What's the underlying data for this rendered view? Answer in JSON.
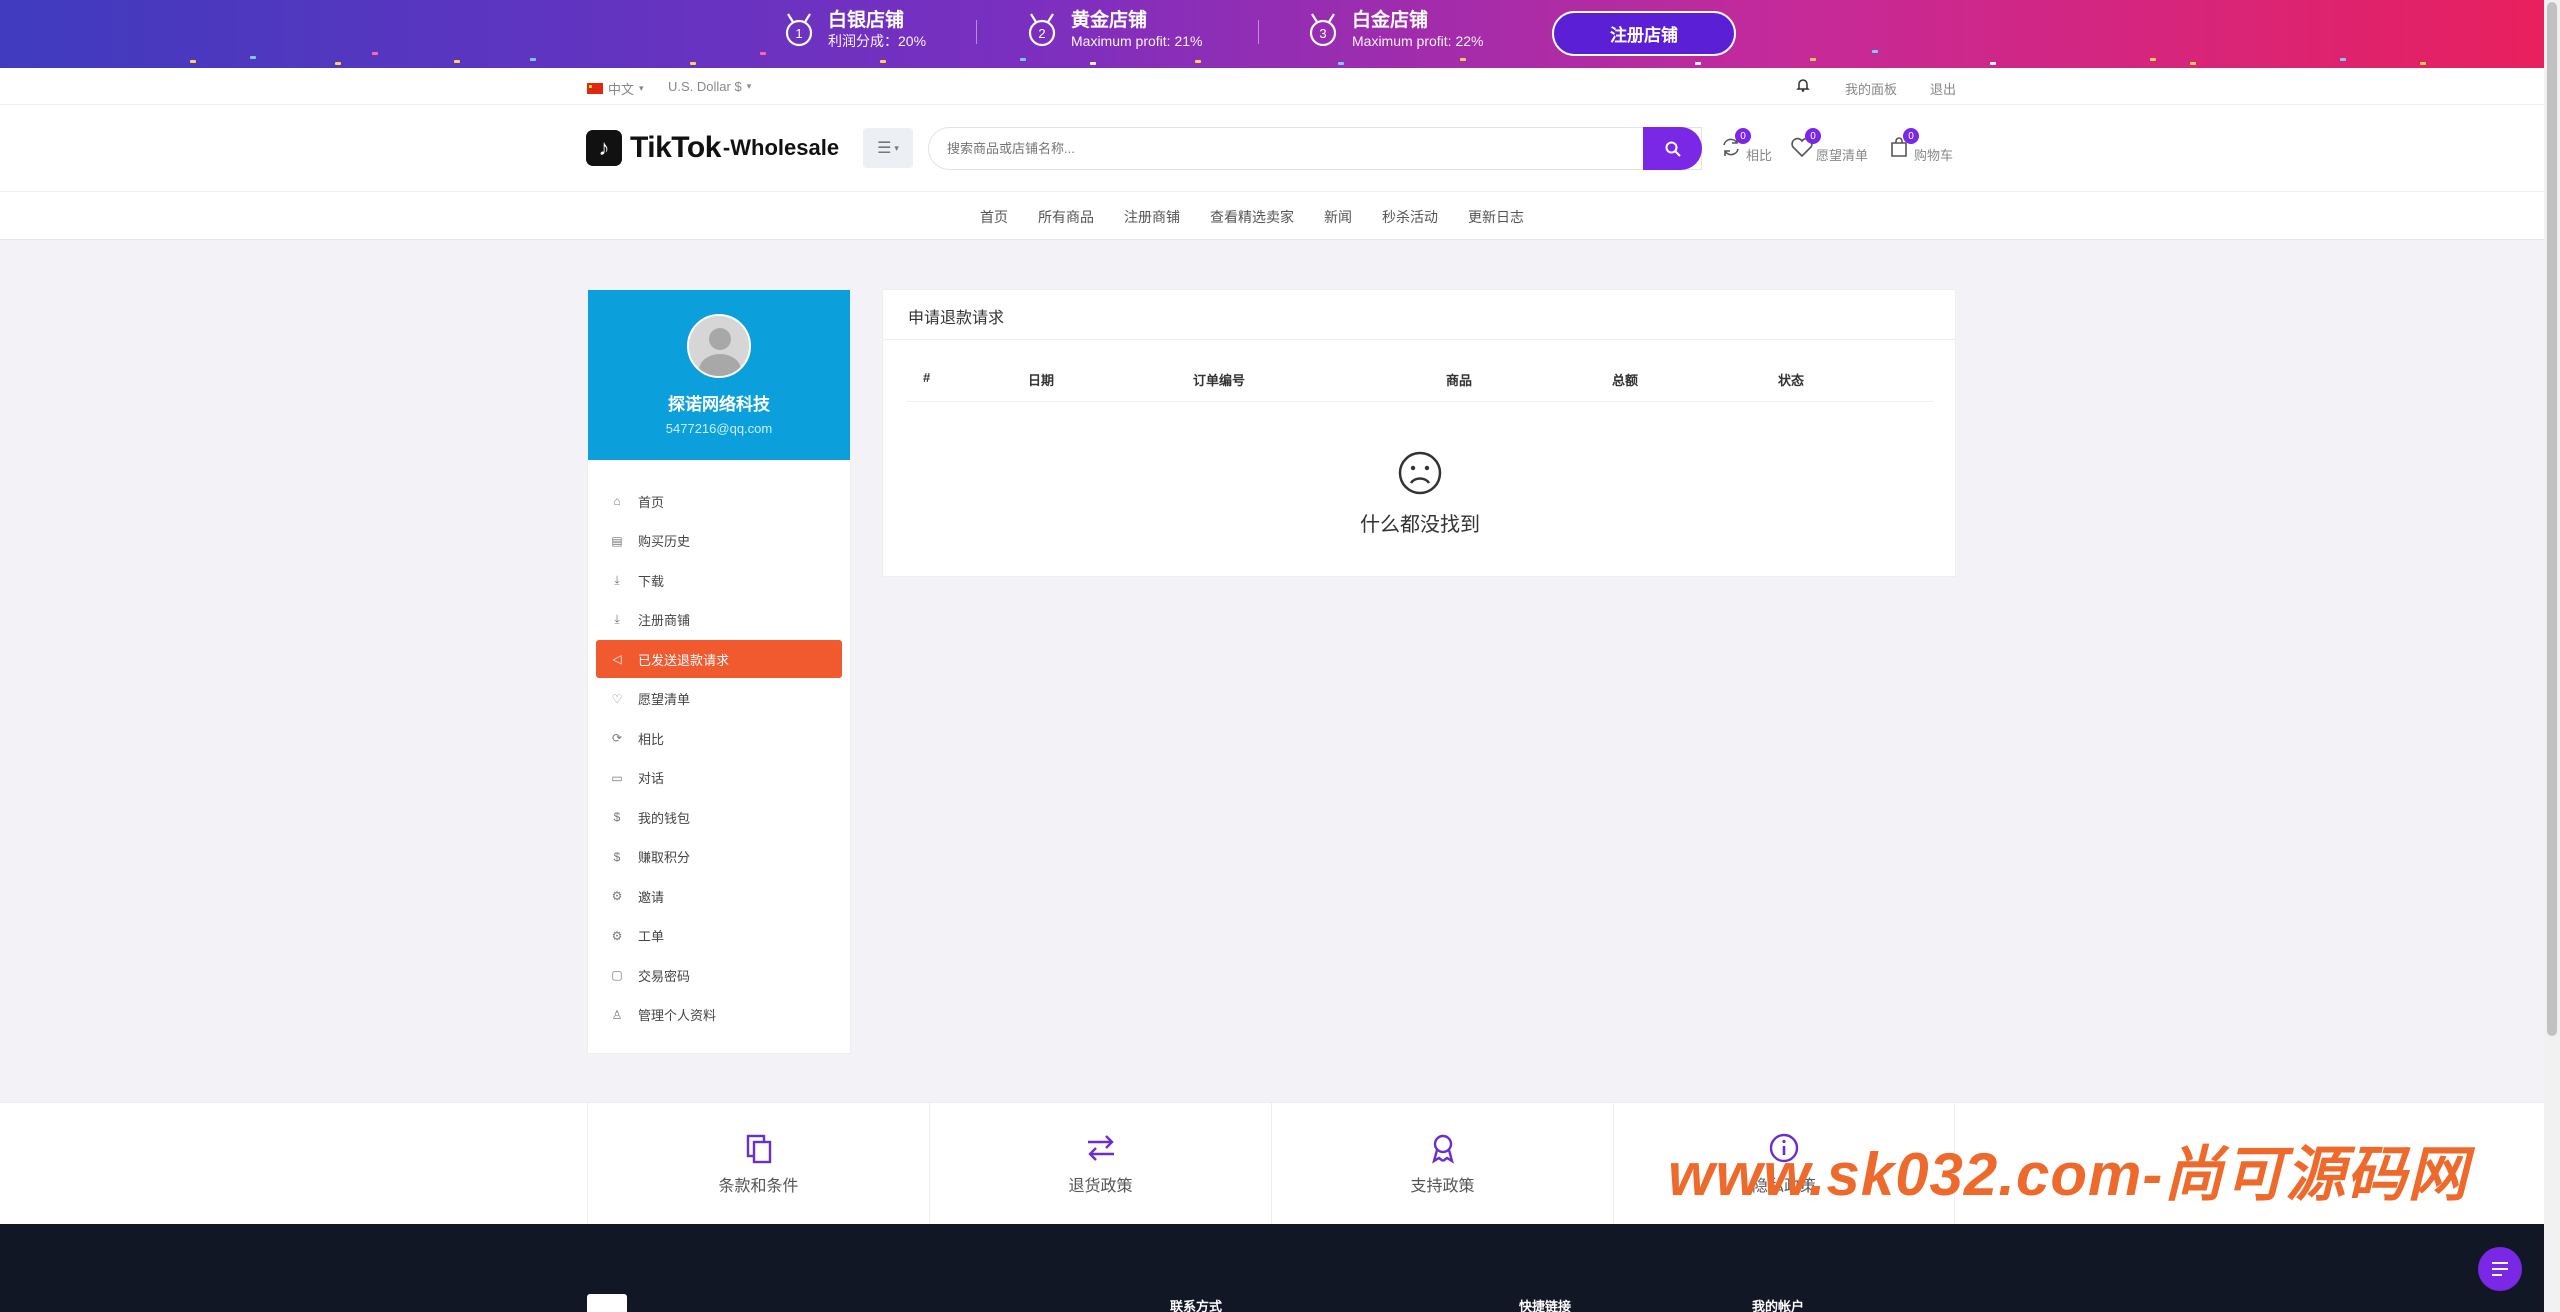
{
  "banner": {
    "tiers": [
      {
        "title": "白银店铺",
        "sub": "利润分成：20%"
      },
      {
        "title": "黄金店铺",
        "sub": "Maximum profit: 21%"
      },
      {
        "title": "白金店铺",
        "sub": "Maximum profit: 22%"
      }
    ],
    "register_label": "注册店铺",
    "colors": {
      "start": "#3f3bbf",
      "end": "#e8205e",
      "button": "#5b1fd6"
    }
  },
  "topbar": {
    "language": "中文",
    "currency": "U.S. Dollar $",
    "dashboard": "我的面板",
    "logout": "退出"
  },
  "header": {
    "brand": "TikTok",
    "brand_sub": "-Wholesale",
    "search_placeholder": "搜索商品或店铺名称...",
    "compare": {
      "label": "相比",
      "count": "0"
    },
    "wishlist": {
      "label": "愿望清单",
      "count": "0"
    },
    "cart": {
      "label": "购物车",
      "count": "0"
    },
    "accent": "#7a28e6"
  },
  "nav": {
    "links": [
      "首页",
      "所有商品",
      "注册商铺",
      "查看精选卖家",
      "新闻",
      "秒杀活动",
      "更新日志"
    ]
  },
  "sidebar": {
    "user_name": "探诺网络科技",
    "user_email": "5477216@qq.com",
    "items": [
      {
        "label": "首页",
        "icon": "home-icon"
      },
      {
        "label": "购买历史",
        "icon": "file-icon"
      },
      {
        "label": "下载",
        "icon": "download-icon"
      },
      {
        "label": "注册商铺",
        "icon": "download-icon"
      },
      {
        "label": "已发送退款请求",
        "icon": "megaphone-icon",
        "active": true
      },
      {
        "label": "愿望清单",
        "icon": "heart-icon"
      },
      {
        "label": "相比",
        "icon": "refresh-icon"
      },
      {
        "label": "对话",
        "icon": "chat-icon"
      },
      {
        "label": "我的钱包",
        "icon": "dollar-icon"
      },
      {
        "label": "赚取积分",
        "icon": "dollar-icon"
      },
      {
        "label": "邀请",
        "icon": "gear-icon"
      },
      {
        "label": "工单",
        "icon": "gear-icon"
      },
      {
        "label": "交易密码",
        "icon": "wallet-icon"
      },
      {
        "label": "管理个人资料",
        "icon": "user-icon"
      }
    ],
    "profile_bg": "#0ba0dc",
    "active_bg": "#f1592f"
  },
  "content": {
    "title": "申请退款请求",
    "columns": [
      "#",
      "日期",
      "订单编号",
      "商品",
      "总额",
      "状态"
    ],
    "empty_text": "什么都没找到"
  },
  "policies": [
    {
      "label": "条款和条件",
      "icon": "copy-icon"
    },
    {
      "label": "退货政策",
      "icon": "exchange-icon"
    },
    {
      "label": "支持政策",
      "icon": "award-icon"
    },
    {
      "label": "隐私政策",
      "icon": "info-icon"
    }
  ],
  "footer": {
    "contact": "联系方式",
    "quick_links": "快捷链接",
    "my_account": "我的帐户"
  },
  "watermark": "www.sk032.com-尚可源码网"
}
